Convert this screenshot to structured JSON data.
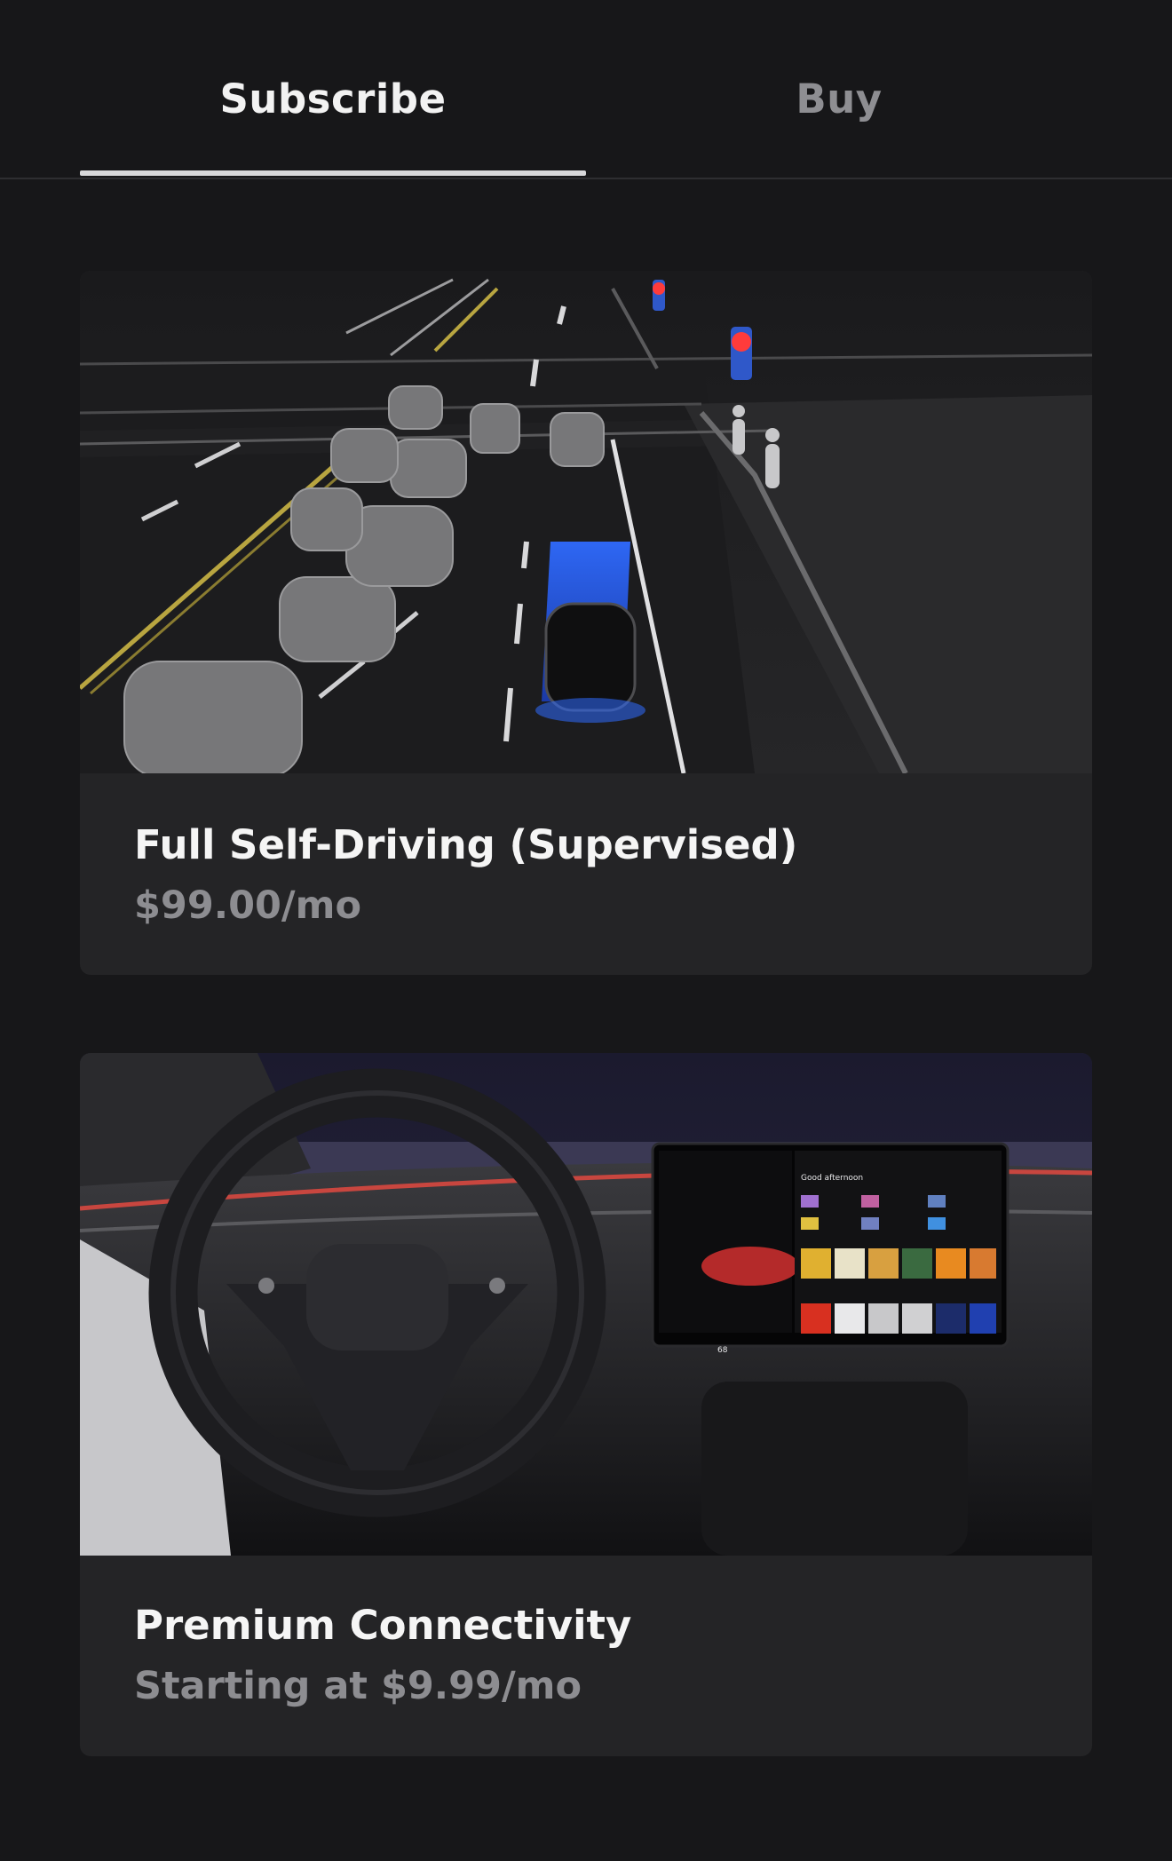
{
  "tabs": {
    "subscribe_label": "Subscribe",
    "buy_label": "Buy",
    "active": "Subscribe"
  },
  "colors": {
    "background": "#171719",
    "card": "#242426",
    "title": "#f5f5f5",
    "price": "#8d8d91",
    "active_tab": "#f2f2f2",
    "inactive_tab": "#8e8e92",
    "ego_highlight": "#2f6bff"
  },
  "cards": [
    {
      "title": "Full Self-Driving (Supervised)",
      "price": "$99.00/mo",
      "image": "fsd-visualization-image"
    },
    {
      "title": "Premium Connectivity",
      "price": "Starting at $9.99/mo",
      "image": "car-interior-image",
      "screen": {
        "greeting": "Good afternoon",
        "speed": "68"
      }
    }
  ]
}
